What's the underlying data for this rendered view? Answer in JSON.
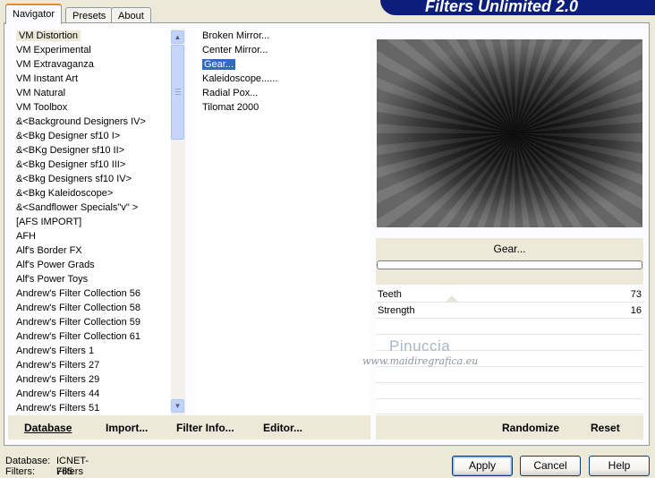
{
  "tabs": [
    {
      "label": "Navigator",
      "active": true
    },
    {
      "label": "Presets",
      "active": false
    },
    {
      "label": "About",
      "active": false
    }
  ],
  "banner_title": "Filters Unlimited 2.0",
  "categories": [
    "VM Distortion",
    "VM Experimental",
    "VM Extravaganza",
    "VM Instant Art",
    "VM Natural",
    "VM Toolbox",
    "&<Background Designers IV>",
    "&<Bkg Designer sf10 I>",
    "&<BKg Designer sf10 II>",
    "&<Bkg Designer sf10 III>",
    "&<Bkg Designers sf10 IV>",
    "&<Bkg Kaleidoscope>",
    "&<Sandflower Specials\"v\" >",
    "[AFS IMPORT]",
    "AFH",
    "Alf's Border FX",
    "Alf's Power Grads",
    "Alf's Power Toys",
    "Andrew's Filter Collection 56",
    "Andrew's Filter Collection 58",
    "Andrew's Filter Collection 59",
    "Andrew's Filter Collection 61",
    "Andrew's Filters 1",
    "Andrew's Filters 27",
    "Andrew's Filters 29",
    "Andrew's Filters 44",
    "Andrew's Filters 51"
  ],
  "selected_category": "VM Distortion",
  "filters": [
    "Broken Mirror...",
    "Center Mirror...",
    "Gear...",
    "Kaleidoscope......",
    "Radial Pox...",
    "Tilomat 2000"
  ],
  "selected_filter": "Gear...",
  "current_filter_label": "Gear...",
  "params": [
    {
      "name": "Teeth",
      "value": "73"
    },
    {
      "name": "Strength",
      "value": "16"
    }
  ],
  "watermark": {
    "name": "Pinuccia",
    "url": "www.maidiregrafica.eu"
  },
  "bottom_links": {
    "database": "Database",
    "import": "Import...",
    "filter_info": "Filter Info...",
    "editor": "Editor...",
    "randomize": "Randomize",
    "reset": "Reset"
  },
  "status": {
    "database_label": "Database:",
    "database_value": "ICNET-Filters",
    "filters_label": "Filters:",
    "filters_value": "765"
  },
  "buttons": {
    "apply": "Apply",
    "cancel": "Cancel",
    "help": "Help"
  },
  "colors": {
    "selection_blue": "#316ac5",
    "banner_blue": "#0b1f7a",
    "window_bg": "#ece9d8"
  }
}
